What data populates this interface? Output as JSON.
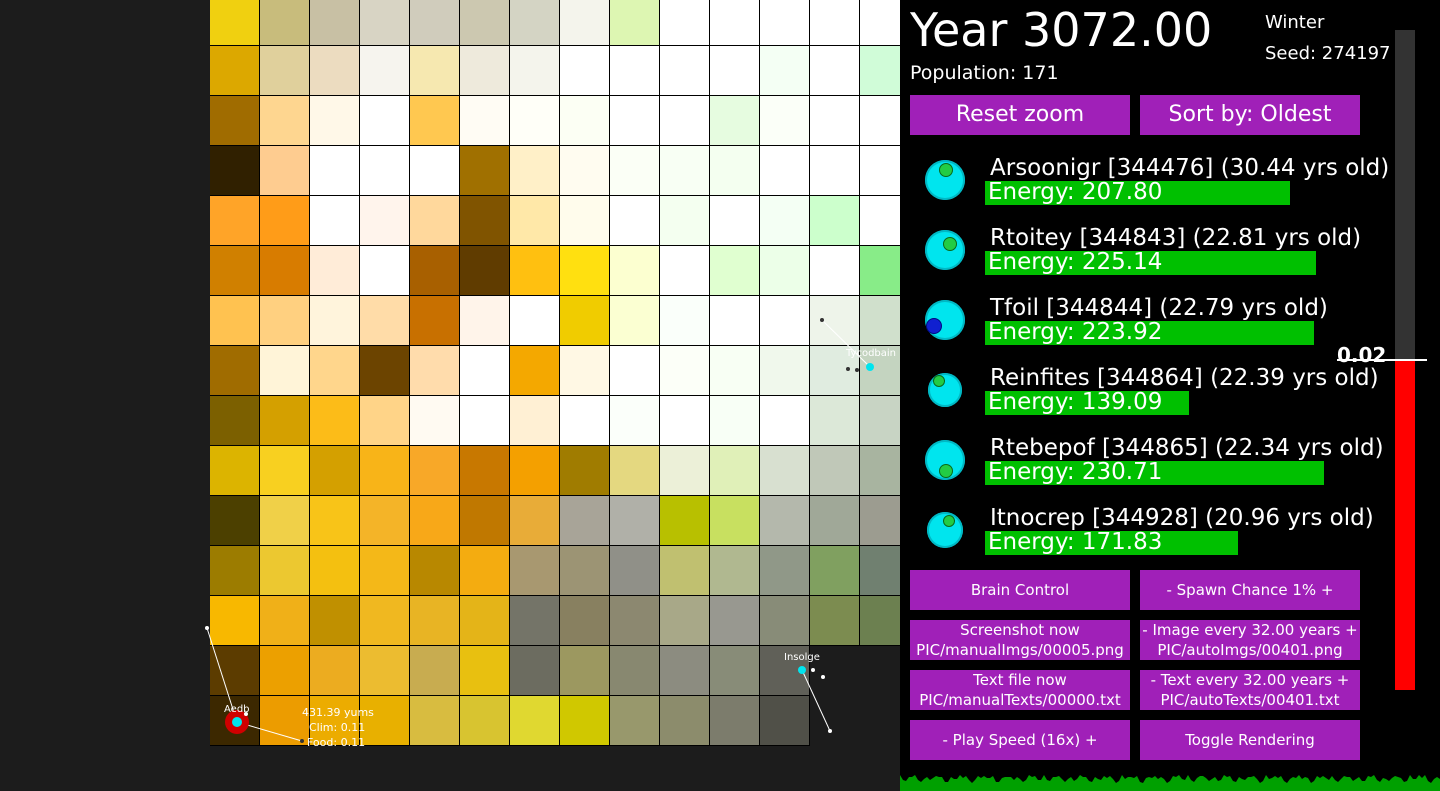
{
  "header": {
    "year": "Year 3072.00",
    "population": "Population: 171",
    "season": "Winter",
    "seed": "Seed: 274197"
  },
  "top_buttons": {
    "reset_zoom": "Reset zoom",
    "sort_by": "Sort by: Oldest"
  },
  "creatures": [
    {
      "name": "Arsoonigr [344476] (30.44 yrs old)",
      "energy": "Energy: 207.80",
      "energy_value": 207.8
    },
    {
      "name": "Rtoitey [344843] (22.81 yrs old)",
      "energy": "Energy: 225.14",
      "energy_value": 225.14
    },
    {
      "name": "Tfoil [344844] (22.79 yrs old)",
      "energy": "Energy: 223.92",
      "energy_value": 223.92
    },
    {
      "name": "Reinfites [344864] (22.39 yrs old)",
      "energy": "Energy: 139.09",
      "energy_value": 139.09
    },
    {
      "name": "Rtebepof [344865] (22.34 yrs old)",
      "energy": "Energy: 230.71",
      "energy_value": 230.71
    },
    {
      "name": "Itnocrep [344928] (20.96 yrs old)",
      "energy": "Energy: 171.83",
      "energy_value": 171.83
    }
  ],
  "controls": {
    "brain_control": "Brain Control",
    "spawn_chance": "-   Spawn Chance 1%   +",
    "screenshot_now": "Screenshot now",
    "screenshot_path": "PIC/manualImgs/00005.png",
    "image_every": "-   Image every 32.00 years   +",
    "image_path": "PIC/autoImgs/00401.png",
    "text_file_now": "Text file now",
    "text_file_path": "PIC/manualTexts/00000.txt",
    "text_every": "-   Text every 32.00 years   +",
    "text_path": "PIC/autoTexts/00401.txt",
    "play_speed": "-    Play Speed (16x)    +",
    "toggle_rendering": "Toggle Rendering"
  },
  "meter": {
    "label": "0.02",
    "fill_fraction": 0.5
  },
  "world": {
    "agents": [
      {
        "label": "Aedb"
      },
      {
        "label": "Tycodbain"
      },
      {
        "label": "Insolge"
      }
    ],
    "selected_info": {
      "line1": "431.39 yums",
      "line2": "Clim: 0.11",
      "line3": "Food: 0.11"
    }
  },
  "colors": {
    "panel_bg": "#000000",
    "button": "#a020b8",
    "energy_bar": "#00c000",
    "creature": "#00e5ee",
    "meter_fill": "#ff0000"
  }
}
